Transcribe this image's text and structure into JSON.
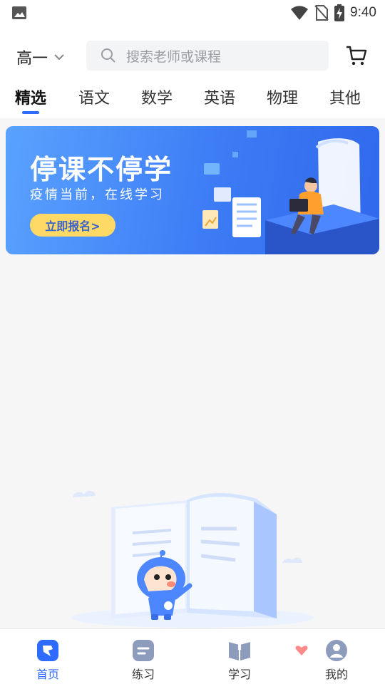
{
  "status_bar": {
    "time": "9:40",
    "left_icon": "image-icon",
    "right_icons": [
      "wifi-icon",
      "no-sim-icon",
      "battery-charging-icon"
    ]
  },
  "header": {
    "grade": "高一",
    "search": {
      "placeholder": "搜索老师或课程"
    },
    "cart_icon": "cart-icon"
  },
  "tabs": [
    {
      "label": "精选",
      "active": true
    },
    {
      "label": "语文",
      "active": false
    },
    {
      "label": "数学",
      "active": false
    },
    {
      "label": "英语",
      "active": false
    },
    {
      "label": "物理",
      "active": false
    },
    {
      "label": "其他",
      "active": false
    }
  ],
  "banner": {
    "title": "停课不停学",
    "subtitle": "疫情当前，在线学习",
    "button": "立即报名>"
  },
  "bottom_nav": [
    {
      "label": "首页",
      "icon": "home-icon",
      "active": true
    },
    {
      "label": "练习",
      "icon": "practice-icon",
      "active": false
    },
    {
      "label": "学习",
      "icon": "study-icon",
      "active": false
    },
    {
      "label": "我的",
      "icon": "profile-icon",
      "active": false
    }
  ],
  "colors": {
    "accent": "#2f6bff",
    "banner_button": "#ffd966"
  }
}
